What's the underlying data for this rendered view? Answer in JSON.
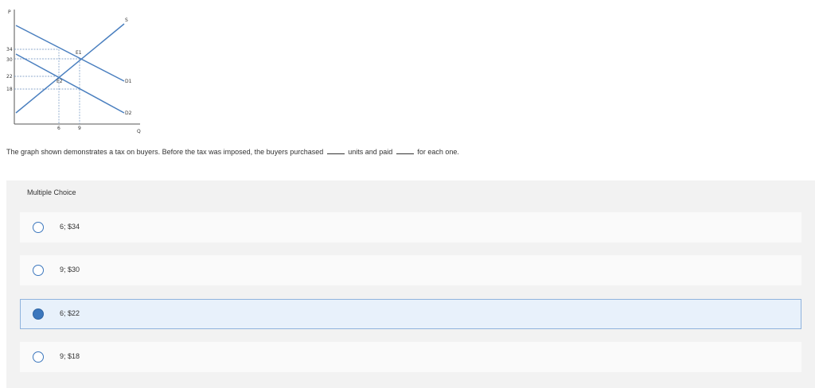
{
  "graph": {
    "axis_y_label": "P",
    "axis_x_label": "Q",
    "y_ticks": [
      "34",
      "30",
      "22",
      "18"
    ],
    "x_ticks": [
      "6",
      "9"
    ],
    "curve_labels": {
      "supply": "S",
      "demand1": "D1",
      "demand2": "D2",
      "eq1": "E1",
      "eq2": "E2"
    },
    "line_color": "#4a7fbf"
  },
  "question": {
    "part1": "The graph shown demonstrates a tax on buyers. Before the tax was imposed, the buyers purchased",
    "part2": "units and paid",
    "part3": "for each one."
  },
  "multiple_choice": {
    "label": "Multiple Choice",
    "options": [
      {
        "label": "6; $34",
        "selected": false
      },
      {
        "label": "9; $30",
        "selected": false
      },
      {
        "label": "6; $22",
        "selected": true
      },
      {
        "label": "9; $18",
        "selected": false
      }
    ]
  }
}
